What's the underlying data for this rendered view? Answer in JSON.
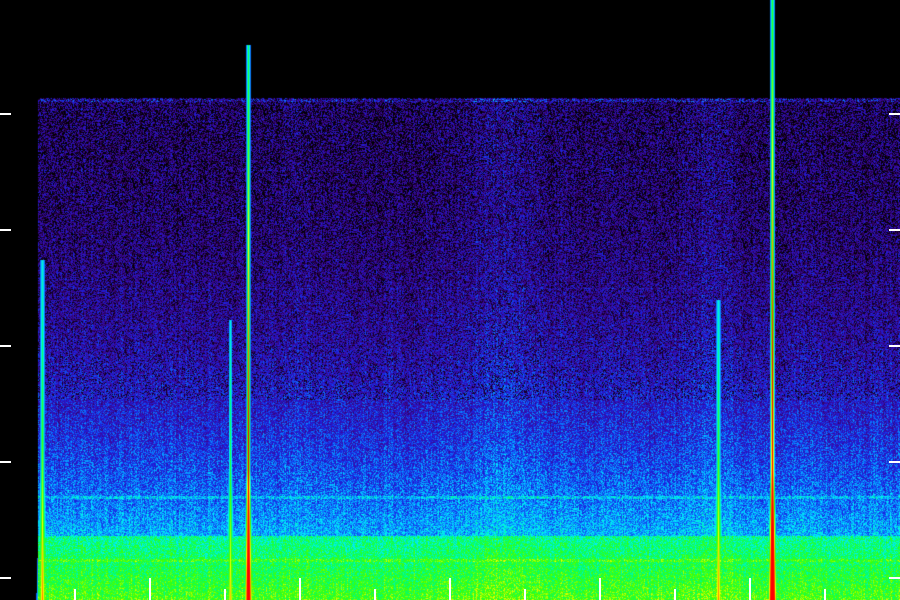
{
  "spectrogram": {
    "palette": [
      "#000000",
      "#2a0050",
      "#3a0aa0",
      "#1a20e0",
      "#0a80ff",
      "#00f0ff",
      "#00ff70",
      "#40ff00",
      "#ffff00",
      "#ff8000",
      "#ff0000"
    ],
    "background_color": "#000000",
    "tick_color": "#ffffff",
    "vertical_streaks": 5,
    "grid": false
  }
}
